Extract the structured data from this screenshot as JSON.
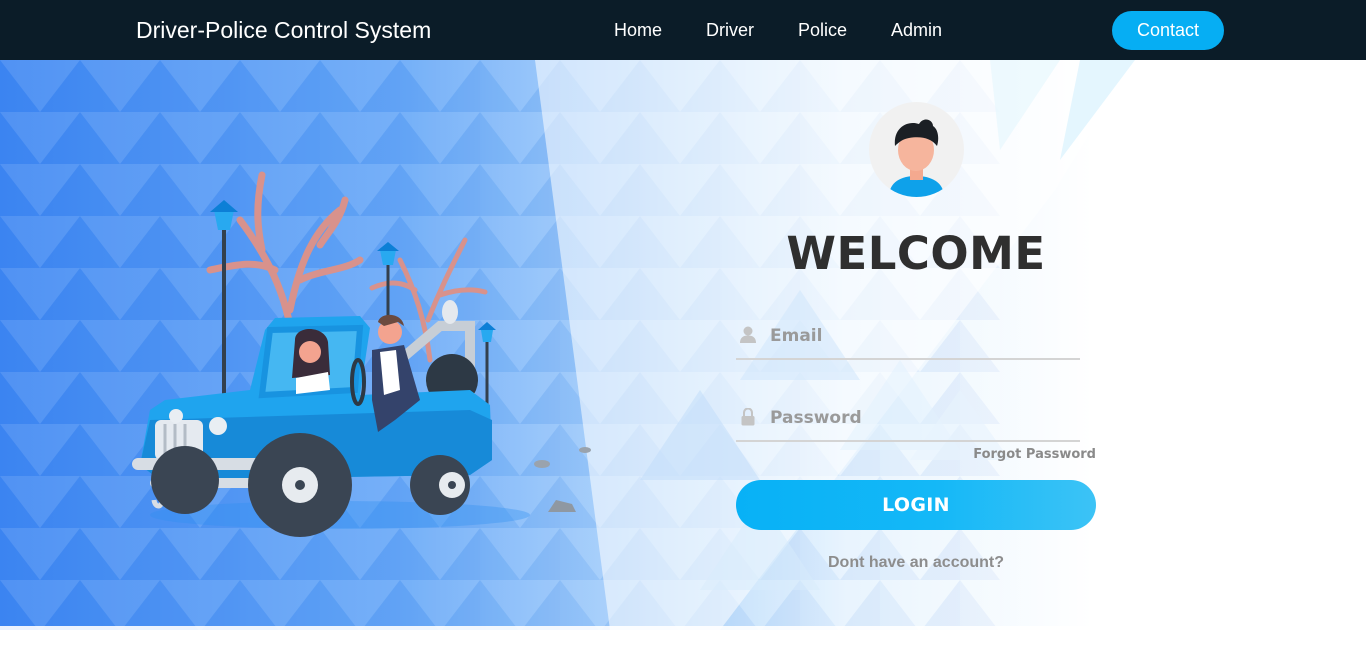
{
  "navbar": {
    "brand": "Driver-Police Control System",
    "links": [
      {
        "label": "Home"
      },
      {
        "label": "Driver"
      },
      {
        "label": "Police"
      },
      {
        "label": "Admin"
      }
    ],
    "contact_label": "Contact"
  },
  "login": {
    "avatar_icon": "user-avatar-icon",
    "title": "WELCOME",
    "email": {
      "placeholder": "Email",
      "icon": "user-icon",
      "value": ""
    },
    "password": {
      "placeholder": "Password",
      "icon": "lock-icon",
      "value": ""
    },
    "forgot_label": "Forgot Password",
    "submit_label": "LOGIN",
    "signup_label": "Dont have an account?"
  },
  "illustration": {
    "icon": "jeep-with-driver-illustration"
  },
  "colors": {
    "navbar_bg": "#0b1c28",
    "accent": "#06aef3",
    "title": "#2f2f2f",
    "muted_text": "#8d8d8d"
  }
}
